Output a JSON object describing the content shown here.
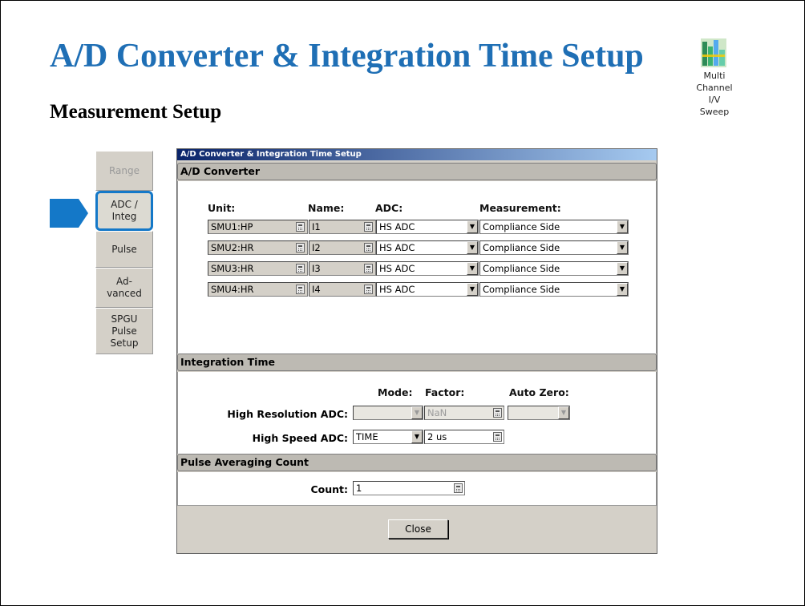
{
  "slide": {
    "title": "A/D Converter & Integration Time Setup",
    "subtitle": "Measurement Setup",
    "app_icon_label": "Multi\nChannel I/V\nSweep"
  },
  "tabs": [
    {
      "label": "Range",
      "state": "disabled"
    },
    {
      "label": "ADC /\nInteg",
      "state": "active"
    },
    {
      "label": "Pulse",
      "state": "normal"
    },
    {
      "label": "Ad-\nvanced",
      "state": "normal"
    },
    {
      "label": "SPGU\nPulse\nSetup",
      "state": "normal"
    }
  ],
  "dialog": {
    "title": "A/D Converter & Integration Time Setup",
    "adc_section": {
      "heading": "A/D Converter",
      "col_unit": "Unit:",
      "col_name": "Name:",
      "col_adc": "ADC:",
      "col_measurement": "Measurement:",
      "rows": [
        {
          "unit": "SMU1:HP",
          "name": "I1",
          "adc": "HS ADC",
          "measurement": "Compliance Side"
        },
        {
          "unit": "SMU2:HR",
          "name": "I2",
          "adc": "HS ADC",
          "measurement": "Compliance Side"
        },
        {
          "unit": "SMU3:HR",
          "name": "I3",
          "adc": "HS ADC",
          "measurement": "Compliance Side"
        },
        {
          "unit": "SMU4:HR",
          "name": "I4",
          "adc": "HS ADC",
          "measurement": "Compliance Side"
        }
      ]
    },
    "integ_section": {
      "heading": "Integration Time",
      "col_mode": "Mode:",
      "col_factor": "Factor:",
      "col_autozero": "Auto Zero:",
      "hr_label": "High Resolution ADC:",
      "hr_mode": "",
      "hr_factor": "NaN",
      "hr_autozero": "",
      "hs_label": "High Speed ADC:",
      "hs_mode": "TIME",
      "hs_factor": "2 us"
    },
    "pulse_section": {
      "heading": "Pulse Averaging Count",
      "count_label": "Count:",
      "count_value": "1"
    },
    "close_label": "Close"
  },
  "colors": {
    "title": "#1f6fb5",
    "accent_pointer": "#1478c8",
    "dialog_bg": "#d4d0c8"
  }
}
